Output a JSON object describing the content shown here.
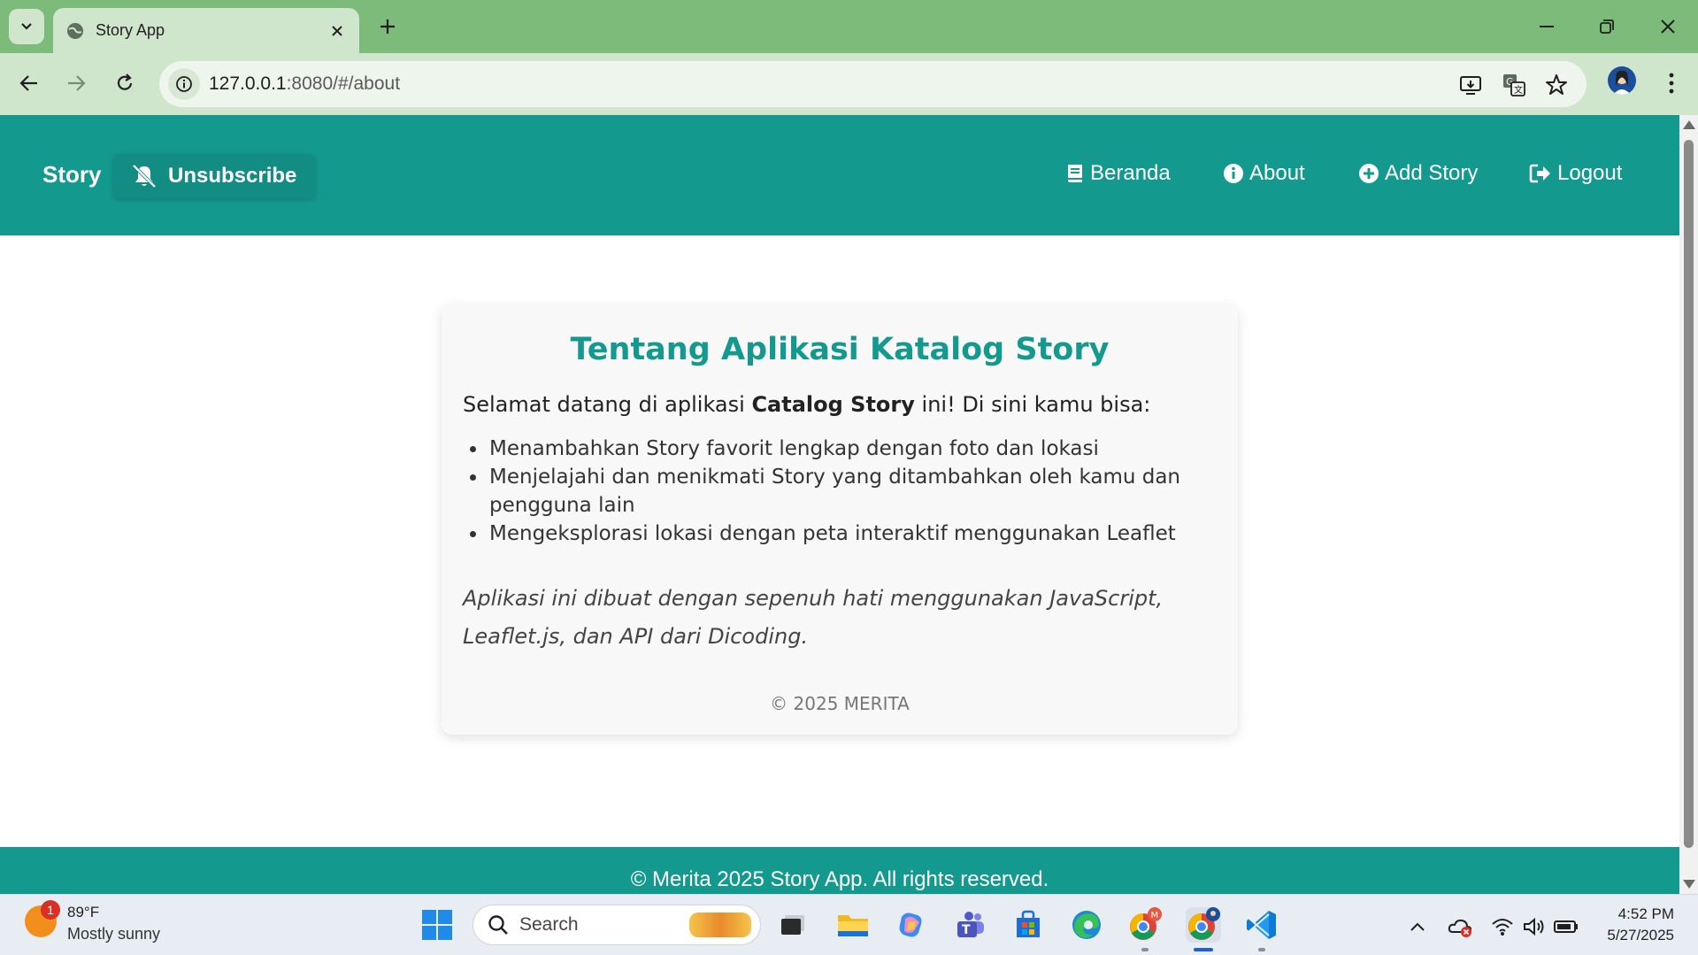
{
  "browser": {
    "tab_title": "Story App",
    "url_host": "127.0.0.1",
    "url_rest": ":8080/#/about"
  },
  "app": {
    "brand": "Story",
    "unsubscribe_label": "Unsubscribe",
    "nav": [
      {
        "label": "Beranda",
        "icon": "book-icon"
      },
      {
        "label": "About",
        "icon": "info-circle-icon"
      },
      {
        "label": "Add Story",
        "icon": "plus-circle-icon"
      },
      {
        "label": "Logout",
        "icon": "logout-icon"
      }
    ],
    "colors": {
      "primary": "#14998f",
      "card_bg": "#f8f8f8"
    }
  },
  "about": {
    "title": "Tentang Aplikasi Katalog Story",
    "intro_before": "Selamat datang di aplikasi ",
    "intro_bold": "Catalog Story",
    "intro_after": " ini! Di sini kamu bisa:",
    "features": [
      "Menambahkan Story favorit lengkap dengan foto dan lokasi",
      "Menjelajahi dan menikmati Story yang ditambahkan oleh kamu dan pengguna lain",
      "Mengeksplorasi lokasi dengan peta interaktif menggunakan Leaflet"
    ],
    "note": "Aplikasi ini dibuat dengan sepenuh hati menggunakan JavaScript, Leaflet.js, dan API dari Dicoding.",
    "copyright": "© 2025 MERITA"
  },
  "footer": {
    "text": "© Merita 2025 Story App. All rights reserved."
  },
  "taskbar": {
    "weather_temp": "89°F",
    "weather_cond": "Mostly sunny",
    "weather_badge": "1",
    "search_label": "Search",
    "time": "4:52 PM",
    "date": "5/27/2025"
  }
}
